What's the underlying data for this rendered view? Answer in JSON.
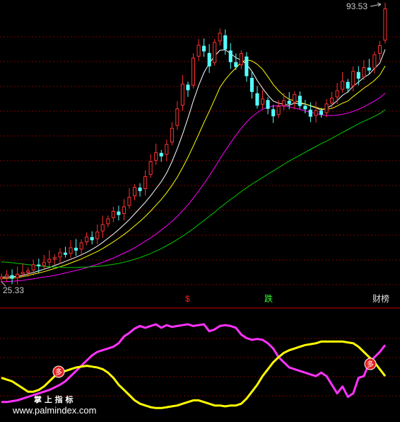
{
  "chart_data": [
    {
      "type": "candlestick",
      "title": "",
      "ylim": [
        25.33,
        93.53
      ],
      "axis_labels": {
        "high": "93.53",
        "low": "25.33"
      },
      "grid": "dashed-horizontal",
      "up_color": "#ff3232",
      "down_color": "#54ffff",
      "closes": [
        27.5,
        28.0,
        27.2,
        28.2,
        28.6,
        29.0,
        30.5,
        30.2,
        31.0,
        31.8,
        32.2,
        33.4,
        33.0,
        34.6,
        34.0,
        35.8,
        37.2,
        36.5,
        38.4,
        40.2,
        41.6,
        43.4,
        42.6,
        44.5,
        46.8,
        49.2,
        48.4,
        51.8,
        55.4,
        57.6,
        56.8,
        59.6,
        63.5,
        68.2,
        74.2,
        72.8,
        80.5,
        83.6,
        82.2,
        78.6,
        84.3,
        86.5,
        82.7,
        79.6,
        78.4,
        81.6,
        76.2,
        72.4,
        69.1,
        70.6,
        68.3,
        66.5,
        68.8,
        70.2,
        69.5,
        71.7,
        69.0,
        68.2,
        66.4,
        67.8,
        66.9,
        69.4,
        70.8,
        72.6,
        74.9,
        73.2,
        77.3,
        75.6,
        78.2,
        77.6,
        81.3,
        83.5,
        92.4
      ],
      "lines": [
        {
          "color": "#ffffff",
          "values": [
            27.5,
            27.5,
            27.6,
            27.7,
            27.9,
            28.3,
            28.6,
            29.0,
            29.4,
            29.8,
            30.3,
            30.8,
            31.3,
            31.8,
            32.3,
            32.9,
            33.5,
            34.2,
            35.0,
            35.9,
            36.9,
            37.9,
            39.0,
            40.2,
            41.4,
            42.8,
            44.2,
            45.6,
            47.2,
            48.9,
            50.6,
            52.7,
            55.4,
            58.6,
            62.1,
            66.0,
            70.1,
            73.8,
            77.0,
            79.2,
            81.0,
            82.4,
            82.5,
            81.6,
            80.6,
            80.0,
            79.0,
            77.3,
            75.1,
            73.2,
            71.5,
            70.1,
            69.6,
            69.3,
            69.1,
            69.6,
            69.4,
            69.4,
            68.9,
            68.5,
            67.9,
            68.3,
            69.1,
            70.2,
            71.5,
            72.3,
            73.7,
            74.7,
            75.8,
            76.6,
            78.0,
            79.3,
            82.6
          ]
        },
        {
          "color": "#ffff00",
          "values": [
            27.2,
            27.2,
            27.3,
            27.4,
            27.6,
            27.9,
            28.2,
            28.5,
            28.8,
            29.2,
            29.6,
            30.0,
            30.4,
            30.9,
            31.4,
            31.9,
            32.5,
            33.1,
            33.7,
            34.4,
            35.2,
            36.0,
            36.9,
            37.8,
            38.8,
            39.9,
            41.0,
            42.2,
            43.5,
            44.9,
            46.3,
            47.9,
            49.7,
            51.7,
            54.0,
            56.5,
            59.2,
            62.0,
            64.9,
            67.6,
            70.5,
            73.4,
            75.3,
            76.8,
            78.1,
            79.5,
            80.1,
            79.8,
            79.0,
            77.8,
            76.0,
            74.1,
            72.6,
            71.4,
            70.5,
            70.2,
            69.8,
            69.4,
            69.0,
            68.6,
            68.2,
            68.1,
            68.3,
            68.9,
            69.6,
            70.1,
            71.2,
            72.2,
            73.2,
            74.1,
            75.1,
            76.4,
            78.6
          ]
        },
        {
          "color": "#ff00ff",
          "values": [
            26.4,
            26.4,
            26.5,
            26.6,
            26.7,
            26.9,
            27.1,
            27.3,
            27.5,
            27.7,
            27.9,
            28.2,
            28.5,
            28.8,
            29.1,
            29.4,
            29.8,
            30.2,
            30.6,
            31.1,
            31.6,
            32.1,
            32.7,
            33.3,
            33.9,
            34.6,
            35.4,
            36.2,
            37.0,
            37.9,
            38.9,
            39.9,
            41.0,
            42.2,
            43.6,
            45.0,
            46.6,
            48.3,
            50.1,
            52.0,
            54.0,
            56.1,
            58.1,
            60.0,
            61.8,
            63.5,
            65.0,
            66.3,
            67.3,
            68.1,
            68.6,
            68.9,
            69.0,
            68.9,
            68.7,
            68.4,
            68.1,
            67.7,
            67.4,
            67.1,
            66.8,
            66.6,
            66.6,
            66.7,
            66.9,
            67.2,
            67.6,
            68.1,
            68.7,
            69.4,
            70.1,
            70.9,
            72.0
          ]
        },
        {
          "color": "#00cc00",
          "values": [
            31.2,
            31.1,
            31.0,
            30.8,
            30.7,
            30.5,
            30.4,
            30.2,
            30.1,
            30.0,
            29.9,
            29.9,
            29.8,
            29.8,
            29.8,
            29.9,
            29.9,
            30.0,
            30.1,
            30.2,
            30.4,
            30.6,
            30.8,
            31.1,
            31.4,
            31.8,
            32.2,
            32.7,
            33.2,
            33.8,
            34.4,
            35.1,
            35.8,
            36.6,
            37.4,
            38.3,
            39.2,
            40.2,
            41.2,
            42.2,
            43.2,
            44.3,
            45.3,
            46.3,
            47.2,
            48.2,
            49.1,
            50.0,
            50.8,
            51.6,
            52.4,
            53.2,
            54.0,
            54.8,
            55.6,
            56.3,
            57.0,
            57.7,
            58.4,
            59.1,
            59.8,
            60.4,
            61.1,
            61.8,
            62.5,
            63.2,
            63.9,
            64.6,
            65.2,
            65.8,
            66.4,
            67.1,
            68.0
          ]
        }
      ]
    },
    {
      "type": "line",
      "title": "",
      "ylim": [
        0,
        100
      ],
      "grid": "dashed-horizontal",
      "series": [
        {
          "color": "#ff33ff",
          "values": [
            10,
            10,
            11,
            12,
            14,
            16,
            18,
            20,
            22,
            24,
            27,
            30,
            34,
            40,
            46,
            52,
            58,
            64,
            68,
            70,
            72,
            74,
            78,
            86,
            90,
            95,
            98,
            96,
            98,
            100,
            96,
            99,
            97,
            98,
            99,
            100,
            98,
            99,
            100,
            92,
            94,
            98,
            99,
            98,
            96,
            88,
            84,
            82,
            83,
            82,
            78,
            72,
            62,
            56,
            50,
            48,
            46,
            44,
            42,
            40,
            44,
            40,
            30,
            20,
            28,
            16,
            20,
            38,
            40,
            55,
            62,
            68,
            76
          ]
        },
        {
          "color": "#ffff00",
          "values": [
            38,
            36,
            34,
            30,
            26,
            22,
            22,
            24,
            28,
            34,
            40,
            44,
            46,
            48,
            50,
            51,
            52,
            51,
            50,
            48,
            44,
            38,
            30,
            24,
            18,
            12,
            8,
            6,
            4,
            3,
            3,
            4,
            5,
            6,
            8,
            10,
            12,
            12,
            10,
            8,
            6,
            6,
            5,
            6,
            6,
            8,
            14,
            22,
            30,
            40,
            48,
            56,
            62,
            67,
            70,
            72,
            74,
            76,
            77,
            78,
            80,
            80,
            80,
            80,
            80,
            79,
            78,
            74,
            68,
            62,
            56,
            48,
            40
          ]
        }
      ]
    }
  ],
  "markers": {
    "signal_red": "$",
    "signal_green": "跌",
    "signal_right": "财榜",
    "duo": "多"
  },
  "watermark": {
    "line1": "掌 上 指 标",
    "line2": "www.palmindex.com"
  }
}
